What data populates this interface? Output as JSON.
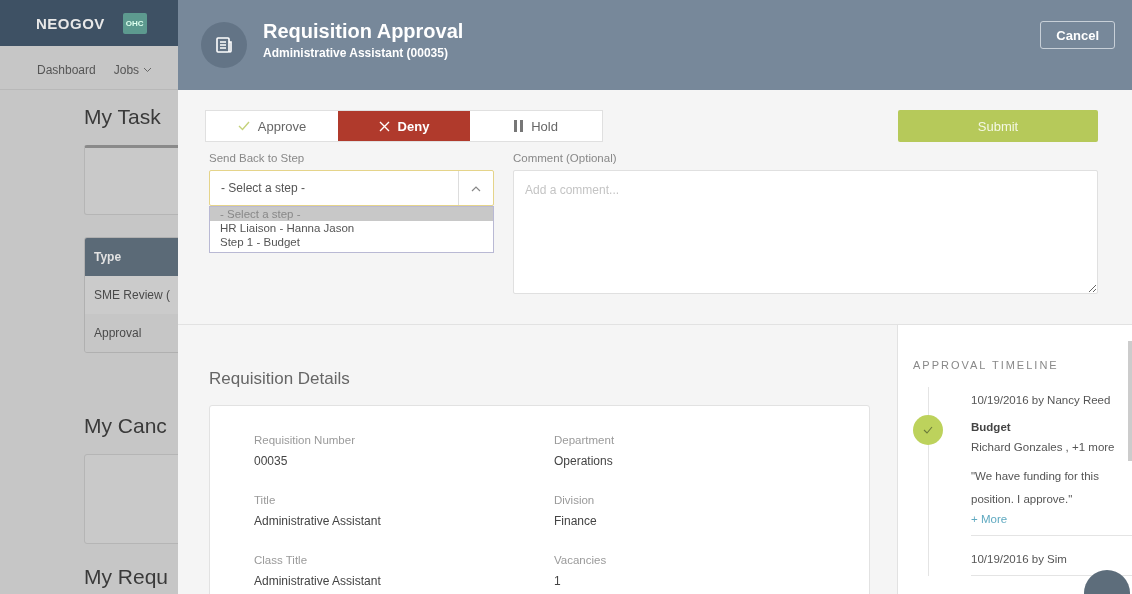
{
  "background_page": {
    "brand": "NEOGOV",
    "badge": "OHC",
    "nav": [
      {
        "label": "Dashboard",
        "dropdown": false
      },
      {
        "label": "Jobs",
        "dropdown": true
      }
    ],
    "tasks_heading": "My Task",
    "table": {
      "header": "Type",
      "rows": [
        "SME Review (",
        "Approval"
      ]
    },
    "candidates_heading": "My Canc",
    "requisitions_heading": "My Requ"
  },
  "dialog": {
    "title": "Requisition Approval",
    "subtitle": "Administrative Assistant (00035)",
    "cancel": "Cancel",
    "decisions": [
      {
        "label": "Approve",
        "kind": "approve",
        "selected": false
      },
      {
        "label": "Deny",
        "kind": "deny",
        "selected": true
      },
      {
        "label": "Hold",
        "kind": "hold",
        "selected": false
      }
    ],
    "submit": "Submit",
    "step_select": {
      "label": "Send Back to Step",
      "value": "- Select a step -",
      "expanded": true,
      "options": [
        {
          "label": "- Select a step -",
          "selected": true
        },
        {
          "label": "HR Liaison - Hanna Jason",
          "selected": false
        },
        {
          "label": "Step 1 - Budget",
          "selected": false
        }
      ]
    },
    "comment": {
      "label": "Comment (Optional)",
      "placeholder": "Add a comment..."
    },
    "details": {
      "heading": "Requisition Details",
      "fields": [
        {
          "label": "Requisition Number",
          "value": "00035"
        },
        {
          "label": "Department",
          "value": "Operations"
        },
        {
          "label": "Title",
          "value": "Administrative Assistant"
        },
        {
          "label": "Division",
          "value": "Finance"
        },
        {
          "label": "Class Title",
          "value": "Administrative Assistant"
        },
        {
          "label": "Vacancies",
          "value": "1"
        }
      ]
    },
    "timeline": {
      "heading": "APPROVAL TIMELINE",
      "entries": [
        {
          "date_by": "10/19/2016 by Nancy Reed",
          "step": "Budget",
          "people": "Richard Gonzales , +1 more",
          "quote": "\"We have funding for this position. I approve.\"",
          "more": "+ More"
        },
        {
          "date_by": "10/19/2016 by Sim"
        }
      ]
    }
  }
}
